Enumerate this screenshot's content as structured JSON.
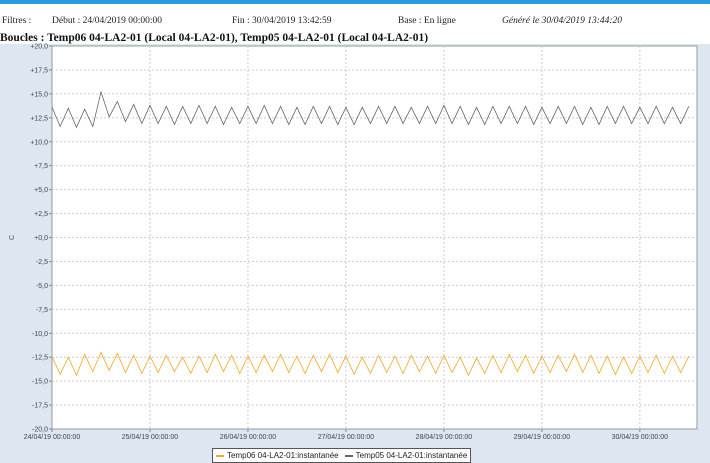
{
  "header": {
    "filters": "Filtres :",
    "start": "Début : 24/04/2019 00:00:00",
    "end": "Fin : 30/04/2019 13:42:59",
    "base": "Base : En ligne",
    "generated": "Généré le 30/04/2019 13:44:20",
    "title": "Boucles : Temp06 04-LA2-01 (Local 04-LA2-01), Temp05 04-LA2-01 (Local 04-LA2-01)"
  },
  "chart_data": {
    "type": "line",
    "ylabel": "C",
    "ylim": [
      -20,
      20
    ],
    "yticks": [
      "+20,0",
      "+17,5",
      "+15,0",
      "+12,5",
      "+10,0",
      "+7,5",
      "+5,0",
      "+2,5",
      "+0,0",
      "-2,5",
      "-5,0",
      "-7,5",
      "-10,0",
      "-12,5",
      "-15,0",
      "-17,5",
      "-20,0"
    ],
    "xlim_hours": [
      0,
      158
    ],
    "xticks": [
      "24/04/19 00:00:00",
      "25/04/19 00:00:00",
      "26/04/19 00:00:00",
      "27/04/19 00:00:00",
      "28/04/19 00:00:00",
      "29/04/19 00:00:00",
      "30/04/19 00:00:00"
    ],
    "x_step_hours": 2,
    "series": [
      {
        "name": "Temp06 04-LA2-01:instantanée",
        "color": "#f5a623",
        "values": [
          -12.4,
          -14.3,
          -12.5,
          -14.4,
          -12.2,
          -14.0,
          -12.0,
          -13.9,
          -12.1,
          -14.1,
          -12.3,
          -14.2,
          -12.4,
          -14.1,
          -12.3,
          -14.0,
          -12.5,
          -14.2,
          -12.4,
          -14.1,
          -12.2,
          -14.0,
          -12.3,
          -14.2,
          -12.4,
          -14.1,
          -12.3,
          -14.0,
          -12.2,
          -14.1,
          -12.4,
          -14.2,
          -12.3,
          -14.0,
          -12.2,
          -14.1,
          -12.4,
          -14.3,
          -12.5,
          -14.2,
          -12.3,
          -14.1,
          -12.4,
          -14.2,
          -12.3,
          -14.0,
          -12.4,
          -14.2,
          -12.3,
          -14.1,
          -12.5,
          -14.4,
          -12.6,
          -14.2,
          -12.3,
          -14.1,
          -12.2,
          -14.0,
          -12.3,
          -14.2,
          -12.4,
          -14.1,
          -12.3,
          -14.0,
          -12.2,
          -14.1,
          -12.3,
          -14.2,
          -12.4,
          -14.3,
          -12.5,
          -14.2,
          -12.4,
          -14.1,
          -12.3,
          -14.2,
          -12.4,
          -14.1,
          -12.4
        ]
      },
      {
        "name": "Temp05 04-LA2-01:instantanée",
        "color": "#666666",
        "values": [
          13.6,
          11.6,
          13.5,
          11.5,
          13.4,
          11.6,
          15.2,
          12.6,
          14.2,
          12.1,
          13.9,
          11.9,
          13.8,
          11.9,
          13.7,
          11.8,
          13.7,
          11.9,
          13.8,
          11.9,
          13.7,
          11.8,
          13.6,
          11.9,
          13.7,
          11.9,
          13.8,
          11.9,
          13.7,
          11.8,
          13.6,
          11.8,
          13.7,
          11.9,
          13.7,
          11.8,
          13.6,
          11.8,
          13.6,
          11.9,
          13.7,
          11.9,
          13.7,
          11.9,
          13.6,
          11.9,
          13.7,
          11.9,
          13.8,
          11.9,
          13.7,
          11.8,
          13.6,
          11.8,
          13.7,
          11.9,
          13.7,
          11.9,
          13.7,
          11.8,
          13.6,
          11.9,
          13.7,
          11.9,
          13.7,
          11.8,
          13.6,
          11.8,
          13.7,
          11.9,
          13.7,
          11.9,
          13.6,
          11.9,
          13.7,
          11.9,
          13.6,
          11.9,
          13.7
        ]
      }
    ]
  }
}
